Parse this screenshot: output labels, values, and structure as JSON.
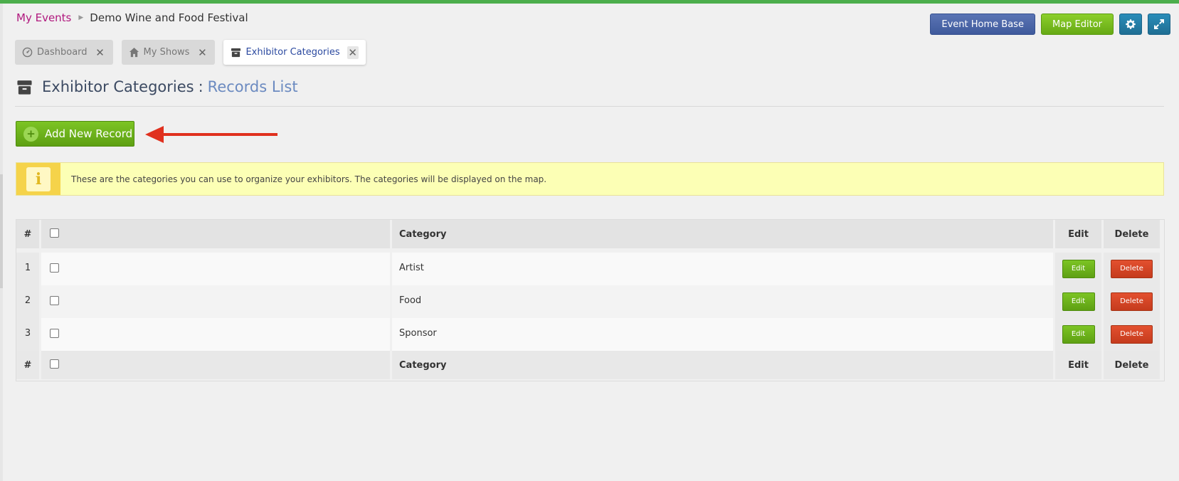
{
  "breadcrumb": {
    "link": "My Events",
    "current": "Demo Wine and Food Festival"
  },
  "top_actions": {
    "event_home_base": "Event Home Base",
    "map_editor": "Map Editor",
    "settings_icon": "gear-icon",
    "fullscreen_icon": "expand-icon"
  },
  "tabs": [
    {
      "label": "Dashboard",
      "icon": "dashboard-icon",
      "active": false
    },
    {
      "label": "My Shows",
      "icon": "home-icon",
      "active": false
    },
    {
      "label": "Exhibitor Categories",
      "icon": "archive-icon",
      "active": true
    }
  ],
  "page_title": {
    "main": "Exhibitor Categories",
    "separator": ":",
    "sub": "Records List"
  },
  "add_button": {
    "label": "Add New Record"
  },
  "info": {
    "text": "These are the categories you can use to organize your exhibitors. The categories will be displayed on the map."
  },
  "table": {
    "headers": {
      "num": "#",
      "category": "Category",
      "edit": "Edit",
      "delete": "Delete"
    },
    "rows": [
      {
        "num": "1",
        "category": "Artist",
        "edit": "Edit",
        "delete": "Delete"
      },
      {
        "num": "2",
        "category": "Food",
        "edit": "Edit",
        "delete": "Delete"
      },
      {
        "num": "3",
        "category": "Sponsor",
        "edit": "Edit",
        "delete": "Delete"
      }
    ]
  },
  "colors": {
    "accent_green": "#66a914",
    "accent_blue": "#3f5a9c",
    "delete_red": "#c53b1d",
    "breadcrumb_link": "#b0187e",
    "info_background": "#fcffb5",
    "annotation_arrow": "#e0301e"
  }
}
